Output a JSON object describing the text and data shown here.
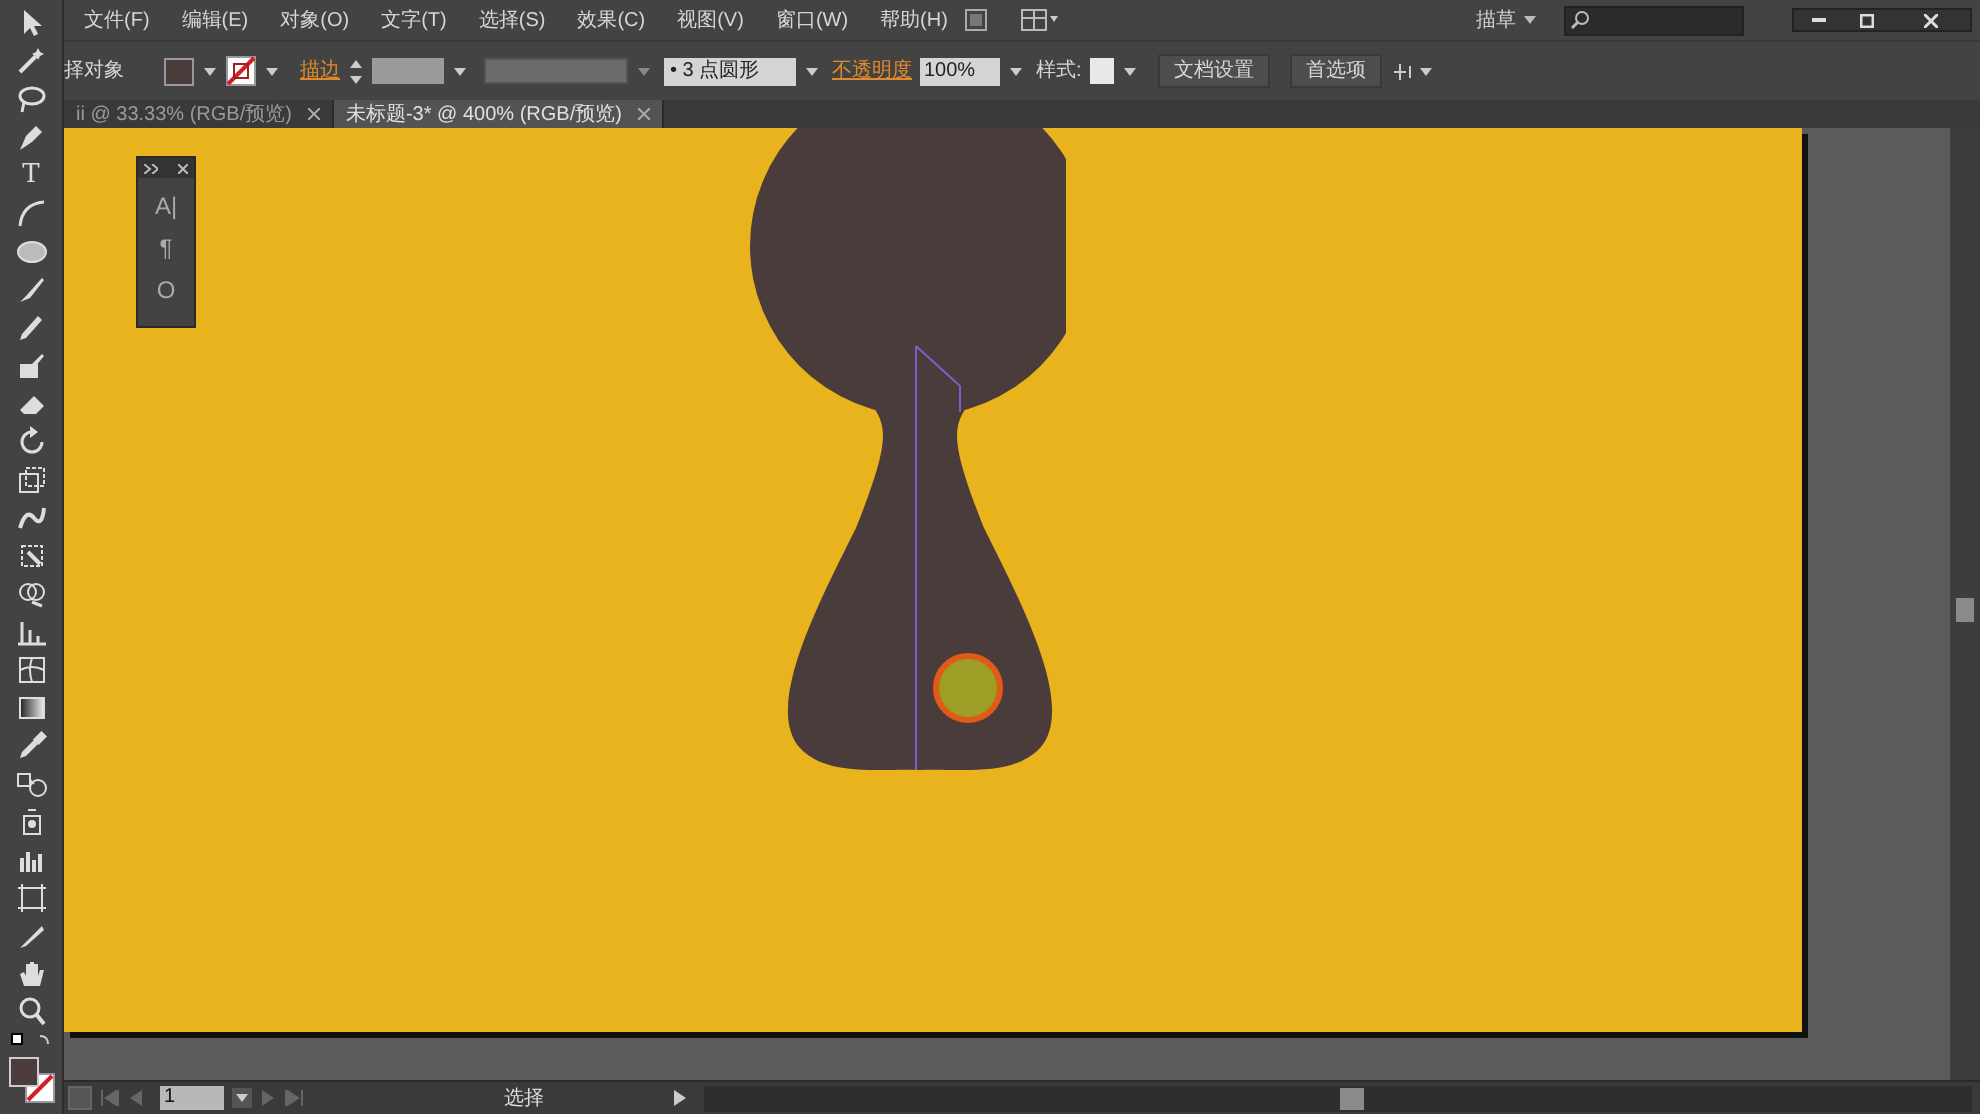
{
  "menu": [
    "文件(F)",
    "编辑(E)",
    "对象(O)",
    "文字(T)",
    "选择(S)",
    "效果(C)",
    "视图(V)",
    "窗口(W)",
    "帮助(H)"
  ],
  "workspace": {
    "label": "描草"
  },
  "control_bar": {
    "selection": "择对象",
    "stroke_label": "描边",
    "brush": "• 3 点圆形",
    "opacity_label": "不透明度",
    "opacity": "100%",
    "style_label": "样式:",
    "buttons": [
      "文档设置",
      "首选项"
    ]
  },
  "tabs": [
    {
      "label": "ii @ 33.33% (RGB/预览)",
      "selected": false
    },
    {
      "label": "未标题-3* @ 400% (RGB/预览)",
      "selected": true
    }
  ],
  "type_tool": "T",
  "panel": {
    "buttons": [
      "A|",
      "¶",
      "O"
    ]
  },
  "status": {
    "page": "1",
    "tool": "选择"
  }
}
